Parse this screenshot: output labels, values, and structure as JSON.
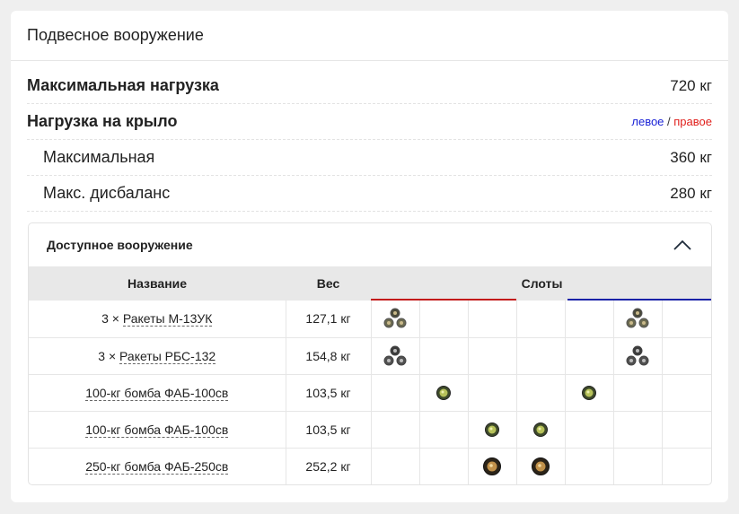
{
  "card": {
    "title": "Подвесное вооружение"
  },
  "stats": {
    "max_load": {
      "label": "Максимальная нагрузка",
      "value": "720 кг"
    },
    "wing_load": {
      "label": "Нагрузка на крыло",
      "legend_left": "левое",
      "legend_sep": " / ",
      "legend_right": "правое"
    },
    "max": {
      "label": "Максимальная",
      "value": "360 кг"
    },
    "imbalance": {
      "label": "Макс. дисбаланс",
      "value": "280 кг"
    }
  },
  "weapons": {
    "title": "Доступное вооружение",
    "columns": {
      "name": "Название",
      "weight": "Вес",
      "slots": "Слоты"
    },
    "rows": [
      {
        "prefix": "3 × ",
        "name": "Ракеты М-13УК",
        "weight": "127,1 кг",
        "slots": [
          "rockets-m13",
          "",
          "",
          "",
          "",
          "rockets-m13",
          ""
        ]
      },
      {
        "prefix": "3 × ",
        "name": "Ракеты РБС-132",
        "weight": "154,8 кг",
        "slots": [
          "rockets-rbs",
          "",
          "",
          "",
          "",
          "rockets-rbs",
          ""
        ]
      },
      {
        "prefix": "",
        "name": "100-кг бомба ФАБ-100св",
        "weight": "103,5 кг",
        "slots": [
          "",
          "bomb-small",
          "",
          "",
          "bomb-small",
          "",
          ""
        ]
      },
      {
        "prefix": "",
        "name": "100-кг бомба ФАБ-100св",
        "weight": "103,5 кг",
        "slots": [
          "",
          "",
          "bomb-small",
          "bomb-small",
          "",
          "",
          ""
        ]
      },
      {
        "prefix": "",
        "name": "250-кг бомба ФАБ-250св",
        "weight": "252,2 кг",
        "slots": [
          "",
          "",
          "bomb-large",
          "bomb-large",
          "",
          "",
          ""
        ]
      }
    ]
  },
  "colors": {
    "left_wing": "#1a22d6",
    "right_wing": "#e0201c"
  }
}
